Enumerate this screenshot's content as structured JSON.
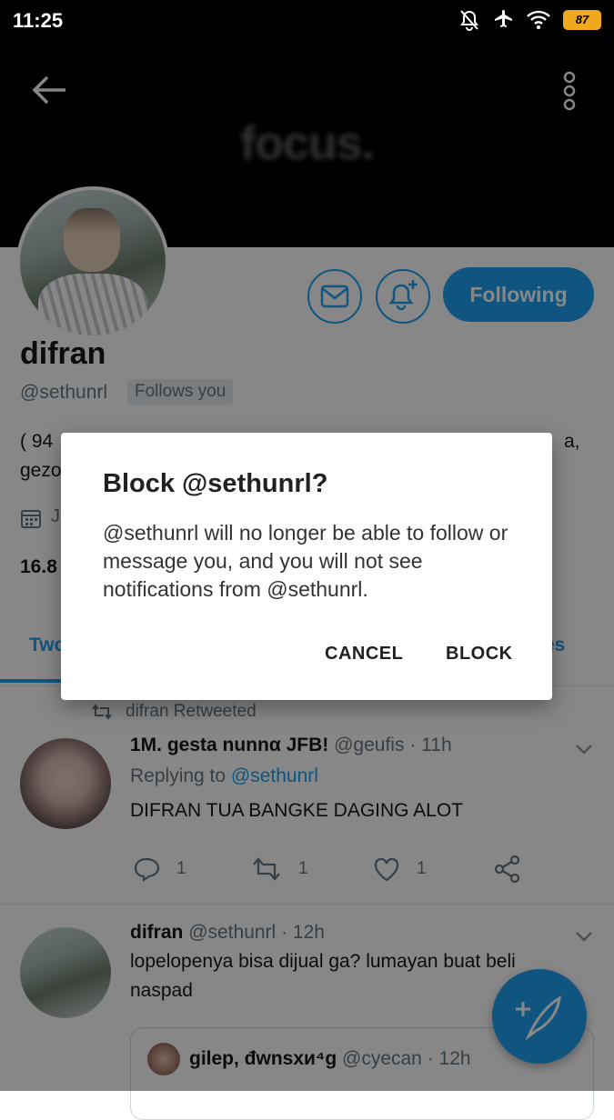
{
  "status_bar": {
    "time": "11:25",
    "battery": "87"
  },
  "header": {
    "banner_text": "focus."
  },
  "profile": {
    "display_name": "difran",
    "handle": "@sethunrl",
    "follows_you": "Follows you",
    "following_label": "Following",
    "bio_line1": "( 94",
    "bio_line1_end": "a,",
    "bio_line2": "gezo",
    "joined": "J",
    "stat": "16.8"
  },
  "tabs": {
    "first": "Two",
    "last": "es"
  },
  "tweets": [
    {
      "retweet_label": "difran Retweeted",
      "name": "1M. gesta nunnα JFB!",
      "handle": "@geufis",
      "time": "· 11h",
      "replying_prefix": "Replying to",
      "replying_handle": "@sethunrl",
      "text": "DIFRAN TUA BANGKE DAGING ALOT",
      "replies": "1",
      "retweets": "1",
      "likes": "1"
    },
    {
      "name": "difran",
      "handle": "@sethunrl",
      "time": "· 12h",
      "text": "lopelopenya bisa dijual ga? lumayan buat beli naspad",
      "quote": {
        "name": "gilep, đwnsxи⁴g",
        "handle": "@cyecan",
        "time": "· 12h"
      }
    }
  ],
  "dialog": {
    "title": "Block @sethunrl?",
    "message": "@sethunrl will no longer be able to follow or message you, and you will not see notifications from @sethunrl.",
    "cancel": "CANCEL",
    "block": "BLOCK"
  },
  "colors": {
    "accent": "#1da1f2",
    "scrim": "rgba(0,0,0,0.47)"
  }
}
